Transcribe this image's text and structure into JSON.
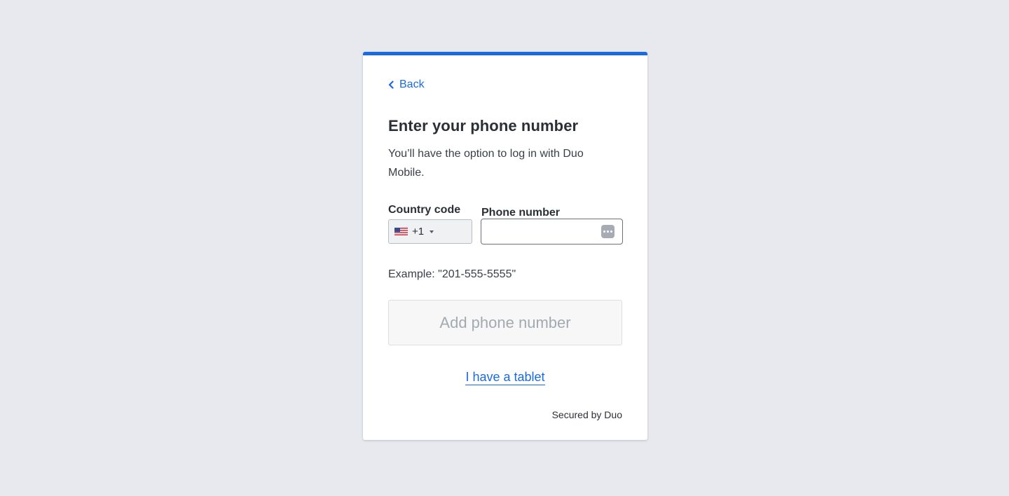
{
  "nav": {
    "back_label": "Back"
  },
  "heading": {
    "title": "Enter your phone number",
    "description": "You’ll have the option to log in with Duo Mobile."
  },
  "form": {
    "country_code_label": "Country code",
    "country_code_value": "+1",
    "country_flag_icon": "us-flag-icon",
    "phone_number_label": "Phone number",
    "phone_number_value": "",
    "autofill_icon": "autofill-dots-icon",
    "example_text": "Example: \"201-555-5555\""
  },
  "actions": {
    "add_phone_label": "Add phone number",
    "tablet_link_label": "I have a tablet"
  },
  "footer": {
    "secured_label": "Secured by Duo"
  },
  "colors": {
    "accent": "#1a6ae3",
    "background": "#e7e9ee",
    "card": "#ffffff",
    "disabled_button_text": "#a4a9b1"
  }
}
